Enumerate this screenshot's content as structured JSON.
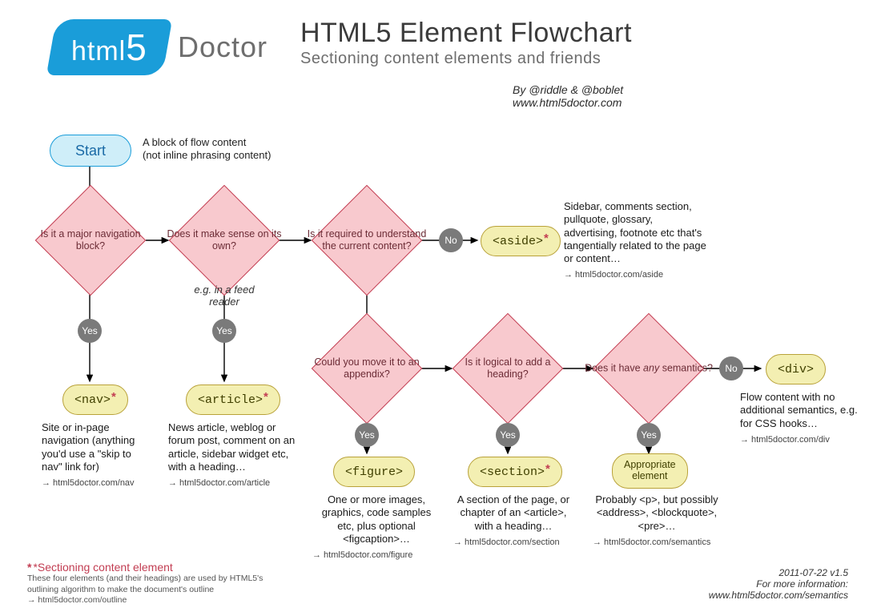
{
  "header": {
    "logo_text": "html",
    "logo_num": "5",
    "logo_sub": "Doctor",
    "title": "HTML5 Element Flowchart",
    "subtitle": "Sectioning content elements and friends",
    "byline_l1": "By @riddle & @boblet",
    "byline_l2": "www.html5doctor.com"
  },
  "start": {
    "label": "Start",
    "ann_l1": "A block of flow content",
    "ann_l2": "(not inline phrasing content)"
  },
  "decisions": {
    "nav": "Is it a major navigation block?",
    "own": "Does it make sense on its own?",
    "req": "Is it required to understand the current content?",
    "apx": "Could you move it to an appendix?",
    "hdg": "Is it logical to add a heading?",
    "sem_a": "Does it have",
    "sem_b": "any",
    "sem_c": "semantics?"
  },
  "badges": {
    "yes": "Yes",
    "no": "No"
  },
  "feed": "e.g. in a feed reader",
  "terms": {
    "nav": "<nav>",
    "article": "<article>",
    "aside": "<aside>",
    "figure": "<figure>",
    "section": "<section>",
    "appropriate_l1": "Appropriate",
    "appropriate_l2": "element",
    "div": "<div>"
  },
  "ann": {
    "nav": "Site or in-page navigation (anything you'd use a \"skip to nav\" link for)",
    "nav_link": "→ html5doctor.com/nav",
    "article": "News article, weblog or forum post, comment on an article, sidebar widget etc, with a heading…",
    "article_link": "→ html5doctor.com/article",
    "aside": "Sidebar, comments section, pullquote, glossary, advertising, footnote etc that's tangentially related to the page or content…",
    "aside_link": "→ html5doctor.com/aside",
    "figure": "One or more images, graphics, code samples etc, plus optional <figcaption>…",
    "figure_link": "→ html5doctor.com/figure",
    "section": "A section of the page, or chapter of an <article>, with a heading…",
    "section_link": "→ html5doctor.com/section",
    "semantics": "Probably <p>, but possibly <address>, <blockquote>, <pre>…",
    "semantics_link": "→ html5doctor.com/semantics",
    "div": "Flow content with no additional semantics, e.g. for CSS hooks…",
    "div_link": "→ html5doctor.com/div"
  },
  "footer": {
    "key_head": "*Sectioning content element",
    "key_body": "These four elements (and their headings) are used by HTML5's outlining algorithm to make the document's outline",
    "key_link": "→ html5doctor.com/outline",
    "info_l1": "2011-07-22 v1.5",
    "info_l2": "For more information:",
    "info_l3": "www.html5doctor.com/semantics"
  }
}
